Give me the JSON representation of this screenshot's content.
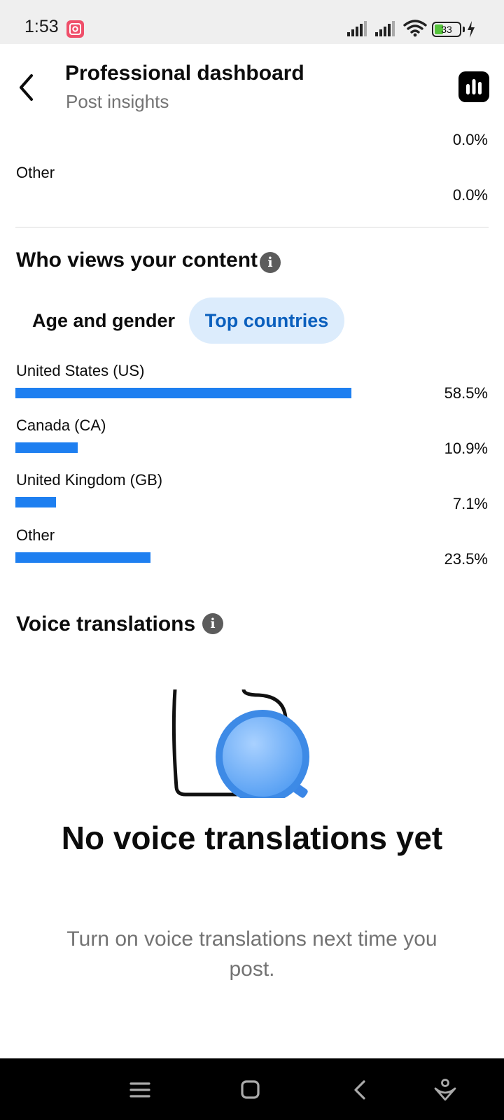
{
  "status_bar": {
    "time": "1:53",
    "battery_level": "33",
    "icons": [
      "screen-recorder-icon",
      "signal-icon",
      "signal-icon",
      "wifi-icon",
      "battery-icon",
      "charging-icon"
    ]
  },
  "header": {
    "title": "Professional dashboard",
    "subtitle": "Post insights",
    "back_icon": "chevron-left-icon",
    "insights_icon": "bar-chart-icon"
  },
  "previous_section": {
    "rows": [
      {
        "label": "",
        "percent": "0.0%"
      },
      {
        "label": "Other",
        "percent": "0.0%"
      }
    ]
  },
  "audience": {
    "title": "Who views your content",
    "tabs": [
      {
        "label": "Age and gender",
        "selected": false
      },
      {
        "label": "Top countries",
        "selected": true
      }
    ],
    "countries": [
      {
        "label": "United States (US)",
        "percent": "58.5%",
        "value": 58.5
      },
      {
        "label": "Canada (CA)",
        "percent": "10.9%",
        "value": 10.9
      },
      {
        "label": "United Kingdom (GB)",
        "percent": "7.1%",
        "value": 7.1
      },
      {
        "label": "Other",
        "percent": "23.5%",
        "value": 23.5
      }
    ],
    "bar_color": "#1e7ff0"
  },
  "voice_translations": {
    "title": "Voice translations",
    "empty_title": "No voice translations yet",
    "empty_description": "Turn on voice translations next time you post."
  },
  "nav_bar": {
    "icons": [
      "menu-icon",
      "home-square-icon",
      "back-icon",
      "assistant-icon"
    ]
  }
}
